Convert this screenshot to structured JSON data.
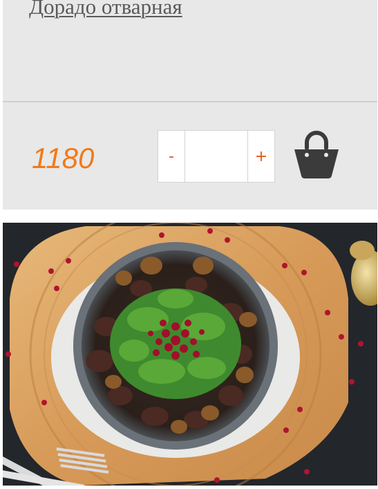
{
  "product": {
    "title": "Дорадо отварная",
    "price": "1180",
    "quantity": {
      "minus_label": "-",
      "plus_label": "+",
      "value": ""
    },
    "cart_icon": "shopping-bag-icon",
    "image_alt": "dish-photo"
  },
  "colors": {
    "price": "#f07a1a",
    "stepper": "#e2581a",
    "card_bg": "#e8e8e8",
    "icon": "#3b3b3b"
  }
}
